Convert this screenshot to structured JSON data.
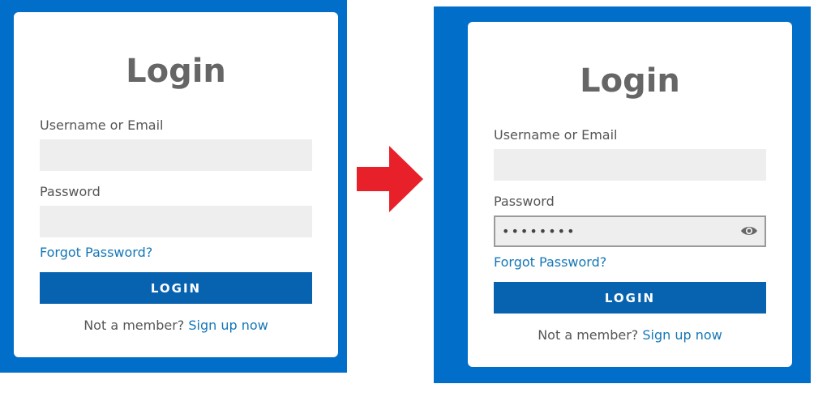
{
  "before": {
    "title": "Login",
    "username_label": "Username or Email",
    "username_value": "",
    "password_label": "Password",
    "password_value": "",
    "forgot_link": "Forgot Password?",
    "login_button": "LOGIN",
    "footer_text": "Not a member?",
    "signup_link": "Sign up now"
  },
  "after": {
    "title": "Login",
    "username_label": "Username or Email",
    "username_value": "",
    "password_label": "Password",
    "password_value": "••••••••",
    "forgot_link": "Forgot Password?",
    "login_button": "LOGIN",
    "footer_text": "Not a member?",
    "signup_link": "Sign up now",
    "reveal_icon": "eye-icon"
  },
  "transition_icon": "right-arrow-icon",
  "colors": {
    "panel": "#016fc9",
    "button": "#0762b0",
    "link": "#1477b8",
    "arrow": "#e8202a",
    "input_bg": "#eeeeee"
  }
}
